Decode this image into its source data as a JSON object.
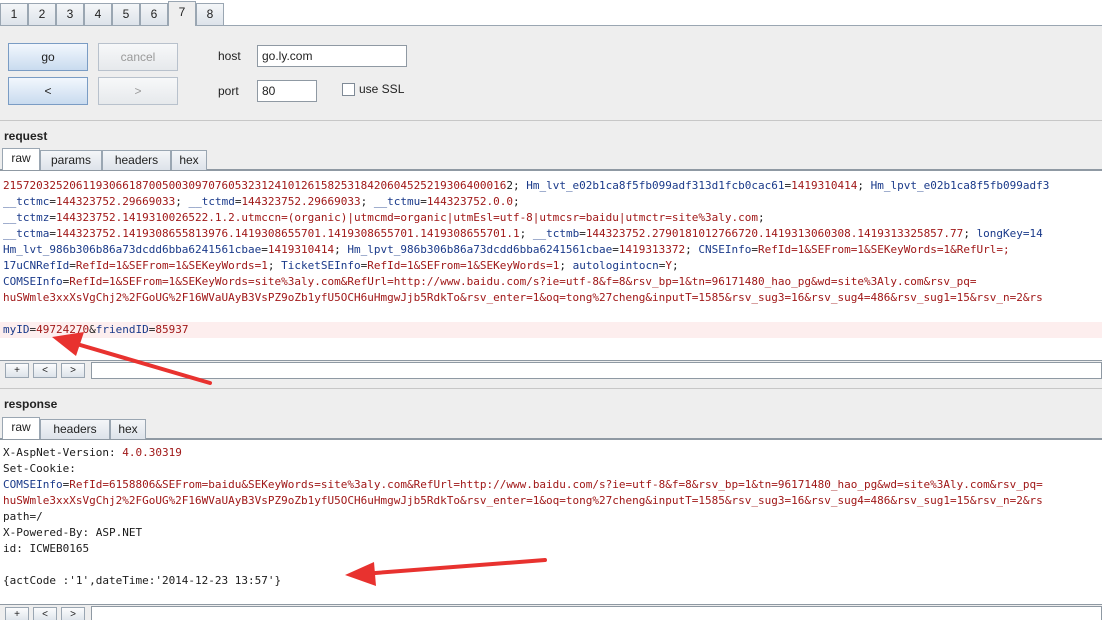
{
  "top_tabs": [
    "1",
    "2",
    "3",
    "4",
    "5",
    "6",
    "7",
    "8"
  ],
  "active_tab_index": 6,
  "buttons": {
    "go": "go",
    "cancel": "cancel",
    "back": "<",
    "forward": ">"
  },
  "host": {
    "label": "host",
    "value": "go.ly.com"
  },
  "port": {
    "label": "port",
    "value": "80"
  },
  "ssl": {
    "label": "use SSL",
    "checked": false
  },
  "request": {
    "title": "request",
    "tabs": [
      "raw",
      "params",
      "headers",
      "hex"
    ],
    "lines": [
      [
        {
          "t": "v",
          "s": "2157203252061193066187005003097076053231241012615825318420604525219306400016"
        },
        {
          "t": "d",
          "s": "2; "
        },
        {
          "t": "k",
          "s": "Hm_lvt_e02b1ca8f5fb099adf313d1fcb0cac61"
        },
        {
          "t": "d",
          "s": "="
        },
        {
          "t": "v",
          "s": "1419310414"
        },
        {
          "t": "d",
          "s": "; "
        },
        {
          "t": "k",
          "s": "Hm_lpvt_e02b1ca8f5fb099adf3"
        }
      ],
      [
        {
          "t": "k",
          "s": "__tctmc"
        },
        {
          "t": "d",
          "s": "="
        },
        {
          "t": "v",
          "s": "144323752.29669033"
        },
        {
          "t": "d",
          "s": "; "
        },
        {
          "t": "k",
          "s": "__tctmd"
        },
        {
          "t": "d",
          "s": "="
        },
        {
          "t": "v",
          "s": "144323752.29669033"
        },
        {
          "t": "d",
          "s": "; "
        },
        {
          "t": "k",
          "s": "__tctmu"
        },
        {
          "t": "d",
          "s": "="
        },
        {
          "t": "v",
          "s": "144323752.0.0"
        },
        {
          "t": "d",
          "s": ";"
        }
      ],
      [
        {
          "t": "k",
          "s": "__tctmz"
        },
        {
          "t": "d",
          "s": "="
        },
        {
          "t": "v",
          "s": "144323752.1419310026522.1.2.utmccn=(organic)|utmcmd=organic|utmEsl=utf-8|utmcsr=baidu|utmctr=site%3aly.com"
        },
        {
          "t": "d",
          "s": ";"
        }
      ],
      [
        {
          "t": "k",
          "s": "__tctma"
        },
        {
          "t": "d",
          "s": "="
        },
        {
          "t": "v",
          "s": "144323752.1419308655813976.1419308655701.1419308655701.1419308655701.1"
        },
        {
          "t": "d",
          "s": "; "
        },
        {
          "t": "k",
          "s": "__tctmb"
        },
        {
          "t": "d",
          "s": "="
        },
        {
          "t": "v",
          "s": "144323752.2790181012766720.1419313060308.1419313325857.77"
        },
        {
          "t": "d",
          "s": "; "
        },
        {
          "t": "k",
          "s": "longKey=14"
        }
      ],
      [
        {
          "t": "k",
          "s": "Hm_lvt_986b306b86a73dcdd6bba6241561cbae"
        },
        {
          "t": "d",
          "s": "="
        },
        {
          "t": "v",
          "s": "1419310414"
        },
        {
          "t": "d",
          "s": "; "
        },
        {
          "t": "k",
          "s": "Hm_lpvt_986b306b86a73dcdd6bba6241561cbae"
        },
        {
          "t": "d",
          "s": "="
        },
        {
          "t": "v",
          "s": "1419313372"
        },
        {
          "t": "d",
          "s": "; "
        },
        {
          "t": "k",
          "s": "CNSEInfo"
        },
        {
          "t": "d",
          "s": "="
        },
        {
          "t": "v",
          "s": "RefId=1&SEFrom=1&SEKeyWords=1&RefUrl=;"
        }
      ],
      [
        {
          "t": "k",
          "s": "17uCNRefId"
        },
        {
          "t": "d",
          "s": "="
        },
        {
          "t": "v",
          "s": "RefId=1&SEFrom=1&SEKeyWords=1"
        },
        {
          "t": "d",
          "s": "; "
        },
        {
          "t": "k",
          "s": "TicketSEInfo"
        },
        {
          "t": "d",
          "s": "="
        },
        {
          "t": "v",
          "s": "RefId=1&SEFrom=1&SEKeyWords=1"
        },
        {
          "t": "d",
          "s": "; "
        },
        {
          "t": "k",
          "s": "autologintocn"
        },
        {
          "t": "d",
          "s": "="
        },
        {
          "t": "v",
          "s": "Y"
        },
        {
          "t": "d",
          "s": ";"
        }
      ],
      [
        {
          "t": "k",
          "s": "COMSEInfo"
        },
        {
          "t": "d",
          "s": "="
        },
        {
          "t": "v",
          "s": "RefId=1&SEFrom=1&SEKeyWords=site%3aly.com&RefUrl=http://www.baidu.com/s?ie=utf-8&f=8&rsv_bp=1&tn=96171480_hao_pg&wd=site%3Aly.com&rsv_pq="
        }
      ],
      [
        {
          "t": "v",
          "s": "huSWmle3xxXsVgChj2%2FGoUG%2F16WVaUAyB3VsPZ9oZb1yfU5OCH6uHmgwJjb5RdkTo&rsv_enter=1&oq=tong%27cheng&inputT=1585&rsv_sug3=16&rsv_sug4=486&rsv_sug1=15&rsv_n=2&rs"
        }
      ],
      [],
      [
        {
          "t": "k",
          "s": "myID"
        },
        {
          "t": "d",
          "s": "="
        },
        {
          "t": "v",
          "s": "49724270"
        },
        {
          "t": "d",
          "s": "&"
        },
        {
          "t": "k",
          "s": "friendID"
        },
        {
          "t": "d",
          "s": "="
        },
        {
          "t": "v",
          "s": "85937"
        }
      ]
    ],
    "nav": [
      "+",
      "<",
      ">"
    ]
  },
  "response": {
    "title": "response",
    "tabs": [
      "raw",
      "headers",
      "hex"
    ],
    "lines": [
      [
        {
          "t": "d",
          "s": "X-AspNet-Version: "
        },
        {
          "t": "v",
          "s": "4.0.30319"
        }
      ],
      [
        {
          "t": "d",
          "s": "Set-Cookie:"
        }
      ],
      [
        {
          "t": "k",
          "s": "COMSEInfo"
        },
        {
          "t": "d",
          "s": "="
        },
        {
          "t": "v",
          "s": "RefId=6158806&SEFrom=baidu&SEKeyWords=site%3aly.com&RefUrl=http://www.baidu.com/s?ie=utf-8&f=8&rsv_bp=1&tn=96171480_hao_pg&wd=site%3Aly.com&rsv_pq="
        }
      ],
      [
        {
          "t": "v",
          "s": "huSWmle3xxXsVgChj2%2FGoUG%2F16WVaUAyB3VsPZ9oZb1yfU5OCH6uHmgwJjb5RdkTo&rsv_enter=1&oq=tong%27cheng&inputT=1585&rsv_sug3=16&rsv_sug4=486&rsv_sug1=15&rsv_n=2&rs"
        }
      ],
      [
        {
          "t": "d",
          "s": "path=/"
        }
      ],
      [
        {
          "t": "d",
          "s": "X-Powered-By: ASP.NET"
        }
      ],
      [
        {
          "t": "d",
          "s": "id: ICWEB0165"
        }
      ],
      [],
      [
        {
          "t": "d",
          "s": "{actCode :'1',dateTime:'2014-12-23 13:57'}"
        }
      ]
    ],
    "nav": [
      "+",
      "<",
      ">"
    ]
  },
  "colors": {
    "key": "#1a3a8a",
    "value": "#a01818",
    "arrow": "#e8322f"
  }
}
